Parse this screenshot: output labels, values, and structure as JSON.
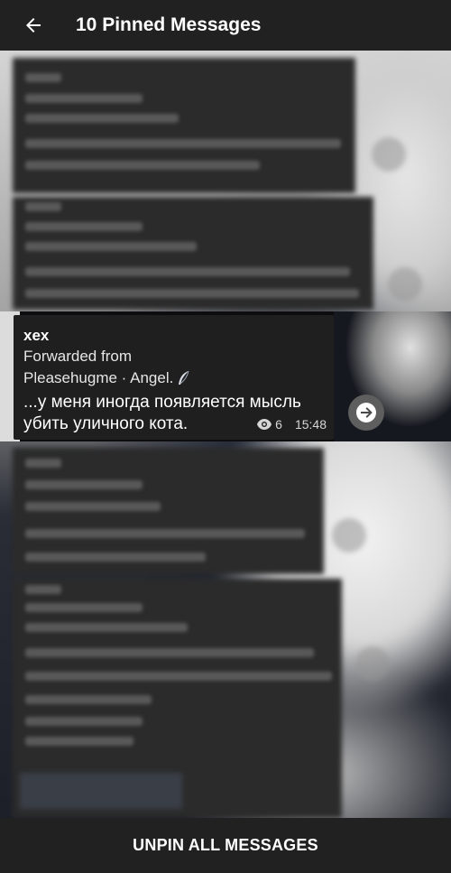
{
  "header": {
    "title": "10 Pinned Messages",
    "back_icon": "arrow-left-icon"
  },
  "message": {
    "sender": "xex",
    "forwarded_label": "Forwarded from",
    "forwarded_source": "Pleasehugme · Angel.",
    "source_badge_icon": "feather-icon",
    "text_line1": "...у меня иногда появляется мысль",
    "text_line2": "убить уличного кота.",
    "views": "6",
    "time": "15:48",
    "share_icon": "share-arrow-icon"
  },
  "footer": {
    "unpin_label": "UNPIN ALL MESSAGES"
  },
  "colors": {
    "header_bg": "#212121",
    "bubble_bg": "#1f1f1f",
    "text": "#ffffff"
  }
}
